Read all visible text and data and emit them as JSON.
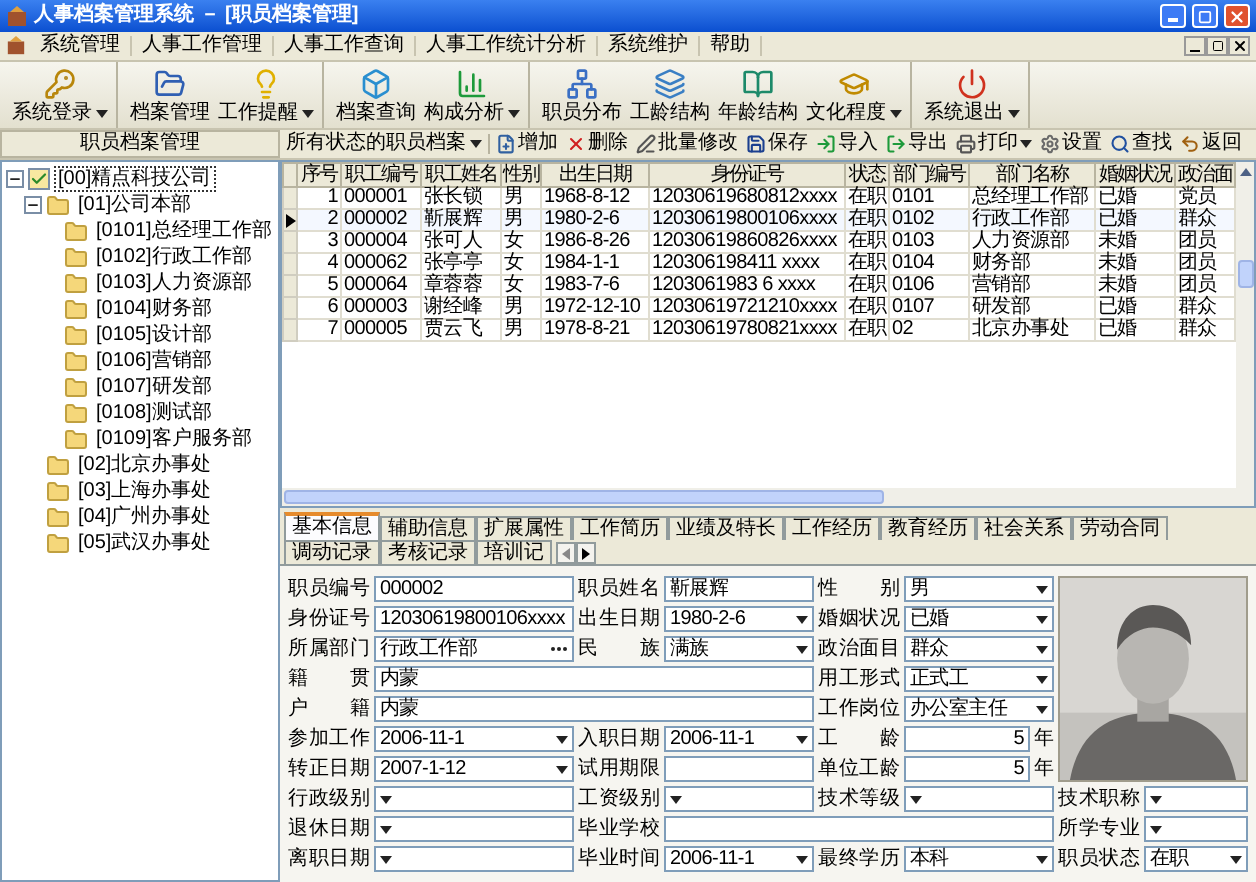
{
  "window": {
    "title": "人事档案管理系统 － [职员档案管理]"
  },
  "menu": [
    "系统管理",
    "人事工作管理",
    "人事工作查询",
    "人事工作统计分析",
    "系统维护",
    "帮助"
  ],
  "toolbar": [
    [
      {
        "label": "系统登录",
        "dropdown": true
      }
    ],
    [
      {
        "label": "档案管理",
        "dropdown": false
      },
      {
        "label": "工作提醒",
        "dropdown": true
      }
    ],
    [
      {
        "label": "档案查询",
        "dropdown": false
      },
      {
        "label": "构成分析",
        "dropdown": true
      }
    ],
    [
      {
        "label": "职员分布",
        "dropdown": false
      },
      {
        "label": "工龄结构",
        "dropdown": false
      },
      {
        "label": "年龄结构",
        "dropdown": false
      },
      {
        "label": "文化程度",
        "dropdown": true
      }
    ],
    [
      {
        "label": "系统退出",
        "dropdown": true
      }
    ]
  ],
  "panel_title": "职员档案管理",
  "filter": "所有状态的职员档案",
  "actions": [
    {
      "label": "增加",
      "dropdown": false
    },
    {
      "label": "删除",
      "dropdown": false
    },
    {
      "label": "批量修改",
      "dropdown": false
    },
    {
      "label": "保存",
      "dropdown": false
    },
    {
      "label": "导入",
      "dropdown": false
    },
    {
      "label": "导出",
      "dropdown": false
    },
    {
      "label": "打印",
      "dropdown": true
    },
    {
      "label": "设置",
      "dropdown": false
    },
    {
      "label": "查找",
      "dropdown": false
    },
    {
      "label": "返回",
      "dropdown": false
    }
  ],
  "tree": [
    {
      "label": "[00]精点科技公司",
      "checked": true,
      "selected": true,
      "expanded": true,
      "children": [
        {
          "label": "[01]公司本部",
          "selected": false,
          "expanded": true,
          "children": [
            {
              "label": "[0101]总经理工作部",
              "selected": false
            },
            {
              "label": "[0102]行政工作部",
              "selected": false
            },
            {
              "label": "[0103]人力资源部",
              "selected": false
            },
            {
              "label": "[0104]财务部",
              "selected": false
            },
            {
              "label": "[0105]设计部",
              "selected": false
            },
            {
              "label": "[0106]营销部",
              "selected": false
            },
            {
              "label": "[0107]研发部",
              "selected": false
            },
            {
              "label": "[0108]测试部",
              "selected": false
            },
            {
              "label": "[0109]客户服务部",
              "selected": false
            }
          ]
        },
        {
          "label": "[02]北京办事处",
          "selected": false
        },
        {
          "label": "[03]上海办事处",
          "selected": false
        },
        {
          "label": "[04]广州办事处",
          "selected": false
        },
        {
          "label": "[05]武汉办事处",
          "selected": false
        }
      ]
    }
  ],
  "grid": {
    "columns": [
      "序号",
      "职工编号",
      "职工姓名",
      "性别",
      "出生日期",
      "身份证号",
      "状态",
      "部门编号",
      "部门名称",
      "婚姻状况",
      "政治面"
    ],
    "rows": [
      {
        "selected": false,
        "cells": [
          "1",
          "000001",
          "张长锁",
          "男",
          "1968-8-12",
          "12030619680812xxxx",
          "在职",
          "0101",
          "总经理工作部",
          "已婚",
          "党员"
        ]
      },
      {
        "selected": true,
        "cells": [
          "2",
          "000002",
          "靳展辉",
          "男",
          "1980-2-6",
          "12030619800106xxxx",
          "在职",
          "0102",
          "行政工作部",
          "已婚",
          "群众"
        ]
      },
      {
        "selected": false,
        "cells": [
          "3",
          "000004",
          "张可人",
          "女",
          "1986-8-26",
          "12030619860826xxxx",
          "在职",
          "0103",
          "人力资源部",
          "未婚",
          "团员"
        ]
      },
      {
        "selected": false,
        "cells": [
          "4",
          "000062",
          "张亭亭",
          "女",
          "1984-1-1",
          "120306198411 xxxx",
          "在职",
          "0104",
          "财务部",
          "未婚",
          "团员"
        ]
      },
      {
        "selected": false,
        "cells": [
          "5",
          "000064",
          "章蓉蓉",
          "女",
          "1983-7-6",
          "1203061983 6 xxxx",
          "在职",
          "0106",
          "营销部",
          "未婚",
          "团员"
        ]
      },
      {
        "selected": false,
        "cells": [
          "6",
          "000003",
          "谢经峰",
          "男",
          "1972-12-10",
          "12030619721210xxxx",
          "在职",
          "0107",
          "研发部",
          "已婚",
          "群众"
        ]
      },
      {
        "selected": false,
        "cells": [
          "7",
          "000005",
          "贾云飞",
          "男",
          "1978-8-21",
          "12030619780821xxxx",
          "在职",
          "02",
          "北京办事处",
          "已婚",
          "群众"
        ]
      }
    ]
  },
  "tabs": [
    {
      "label": "基本信息",
      "selected": true
    },
    {
      "label": "辅助信息",
      "selected": false
    },
    {
      "label": "扩展属性",
      "selected": false
    },
    {
      "label": "工作简历",
      "selected": false
    },
    {
      "label": "业绩及特长",
      "selected": false
    },
    {
      "label": "工作经历",
      "selected": false
    },
    {
      "label": "教育经历",
      "selected": false
    },
    {
      "label": "社会关系",
      "selected": false
    },
    {
      "label": "劳动合同",
      "selected": false
    },
    {
      "label": "调动记录",
      "selected": false
    },
    {
      "label": "考核记录",
      "selected": false
    },
    {
      "label": "培训记",
      "selected": false
    }
  ],
  "fields": [
    {
      "label": "职员编号",
      "kind": "text",
      "value": "000002"
    },
    {
      "label": "职员姓名",
      "kind": "text",
      "value": "靳展辉"
    },
    {
      "label": "性别",
      "kind": "select",
      "value": "男"
    },
    {
      "label": "身份证号",
      "kind": "text",
      "value": "12030619800106xxxx"
    },
    {
      "label": "出生日期",
      "kind": "select",
      "value": "1980-2-6"
    },
    {
      "label": "婚姻状况",
      "kind": "select",
      "value": "已婚"
    },
    {
      "label": "所属部门",
      "kind": "browse",
      "value": "行政工作部"
    },
    {
      "label": "民族",
      "kind": "select",
      "value": "满族"
    },
    {
      "label": "政治面目",
      "kind": "select",
      "value": "群众"
    },
    {
      "label": "籍贯",
      "kind": "wide",
      "value": "内蒙"
    },
    {
      "label": "用工形式",
      "kind": "select",
      "value": "正式工"
    },
    {
      "label": "户籍",
      "kind": "wide",
      "value": "内蒙"
    },
    {
      "label": "工作岗位",
      "kind": "select",
      "value": "办公室主任"
    },
    {
      "label": "参加工作",
      "kind": "select",
      "value": "2006-11-1"
    },
    {
      "label": "入职日期",
      "kind": "select",
      "value": "2006-11-1"
    },
    {
      "label": "工龄",
      "kind": "number",
      "value": "5",
      "unit": "年"
    },
    {
      "label": "转正日期",
      "kind": "select",
      "value": "2007-1-12"
    },
    {
      "label": "试用期限",
      "kind": "text"
    },
    {
      "label": "单位工龄",
      "kind": "number",
      "value": "5",
      "unit": "年"
    },
    {
      "label": "行政级别",
      "kind": "select"
    },
    {
      "label": "工资级别",
      "kind": "select"
    },
    {
      "label": "技术等级",
      "kind": "select"
    },
    {
      "label": "技术职称",
      "kind": "select"
    },
    {
      "label": "退休日期",
      "kind": "select"
    },
    {
      "label": "毕业学校",
      "kind": "wide"
    },
    {
      "label": "所学专业",
      "kind": "select"
    },
    {
      "label": "离职日期",
      "kind": "select"
    },
    {
      "label": "毕业时间",
      "kind": "select",
      "value": "2006-11-1"
    },
    {
      "label": "最终学历",
      "kind": "select",
      "value": "本科"
    },
    {
      "label": "职员状态",
      "kind": "select",
      "value": "在职"
    }
  ]
}
